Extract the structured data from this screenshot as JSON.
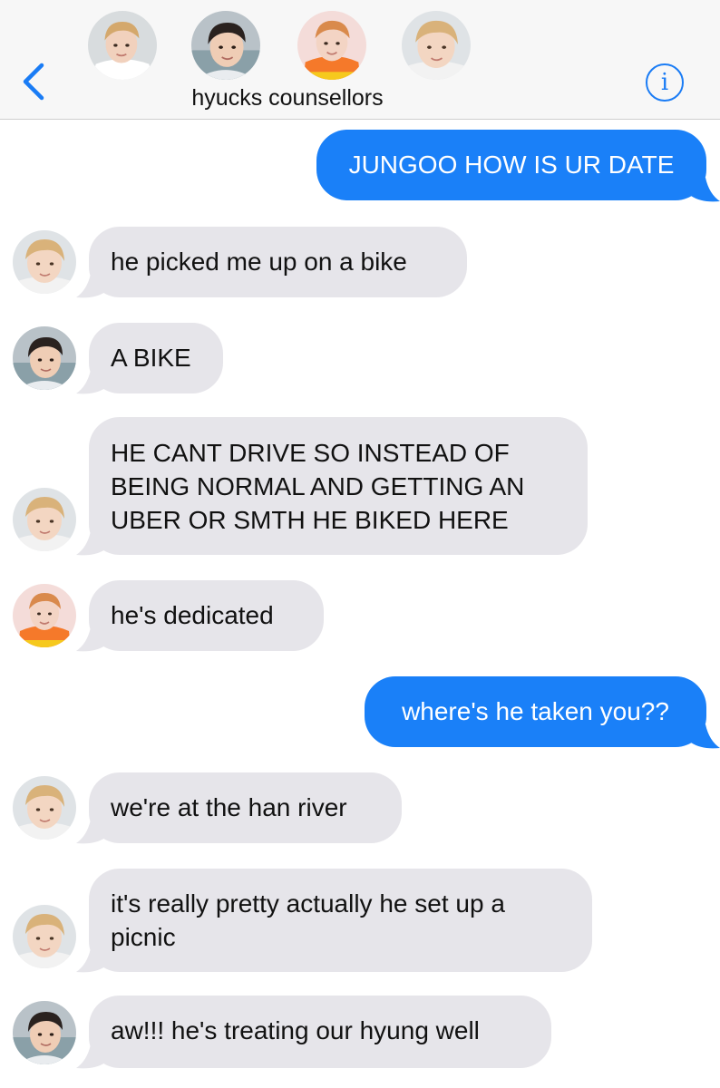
{
  "header": {
    "title": "hyucks counsellors",
    "info_glyph": "i",
    "accent": "#1a7cf5"
  },
  "messages": [
    {
      "dir": "out",
      "text": "JUNGOO HOW IS UR DATE"
    },
    {
      "dir": "in",
      "avatar": "white-hair-hoodie",
      "text": "he picked me up on a bike"
    },
    {
      "dir": "in",
      "avatar": "dark-hair",
      "text": "A BIKE"
    },
    {
      "dir": "in",
      "avatar": "white-hair-hoodie",
      "text": "HE CANT DRIVE SO INSTEAD OF BEING NORMAL AND GETTING AN UBER OR SMTH HE BIKED HERE"
    },
    {
      "dir": "in",
      "avatar": "orange-hoodie",
      "text": "he's dedicated"
    },
    {
      "dir": "out",
      "text": "where's he taken you??"
    },
    {
      "dir": "in",
      "avatar": "white-hair-hoodie",
      "text": "we're at the han river"
    },
    {
      "dir": "in",
      "avatar": "white-hair-hoodie",
      "text": "it's really pretty actually he set up a picnic"
    },
    {
      "dir": "in",
      "avatar": "dark-hair",
      "text": "aw!!! he's treating our hyung well"
    }
  ],
  "colors": {
    "incoming_bubble": "#e6e5ea",
    "outgoing_bubble": "#1a80f8"
  }
}
